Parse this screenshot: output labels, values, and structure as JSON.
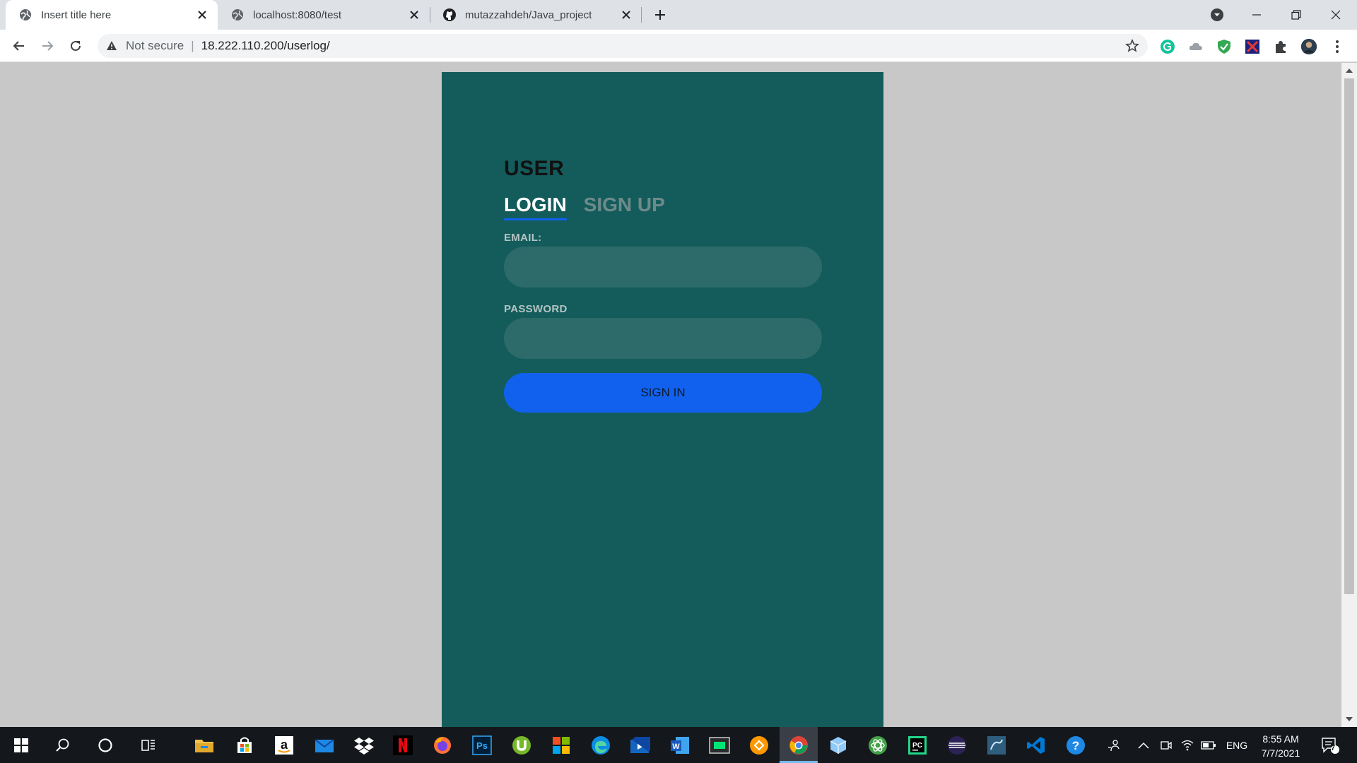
{
  "browser": {
    "tabs": [
      {
        "title": "Insert title here",
        "favicon": "globe-icon",
        "active": true
      },
      {
        "title": "localhost:8080/test",
        "favicon": "globe-icon",
        "active": false
      },
      {
        "title": "mutazzahdeh/Java_project",
        "favicon": "github-icon",
        "active": false
      }
    ],
    "address": {
      "security_label": "Not secure",
      "url": "18.222.110.200/userlog/"
    }
  },
  "page": {
    "title": "USER",
    "tabs": {
      "login": "LOGIN",
      "signup": "SIGN UP"
    },
    "email_label": "EMAIL:",
    "email_value": "",
    "password_label": "PASSWORD",
    "password_value": "",
    "submit_label": "SIGN IN",
    "colors": {
      "card_bg": "#135c5b",
      "accent": "#1161ee",
      "input_bg": "#2c6b69",
      "page_bg": "#c8c8c8"
    }
  },
  "taskbar": {
    "language": "ENG",
    "time": "8:55 AM",
    "date": "7/7/2021",
    "notification_count": "7"
  }
}
